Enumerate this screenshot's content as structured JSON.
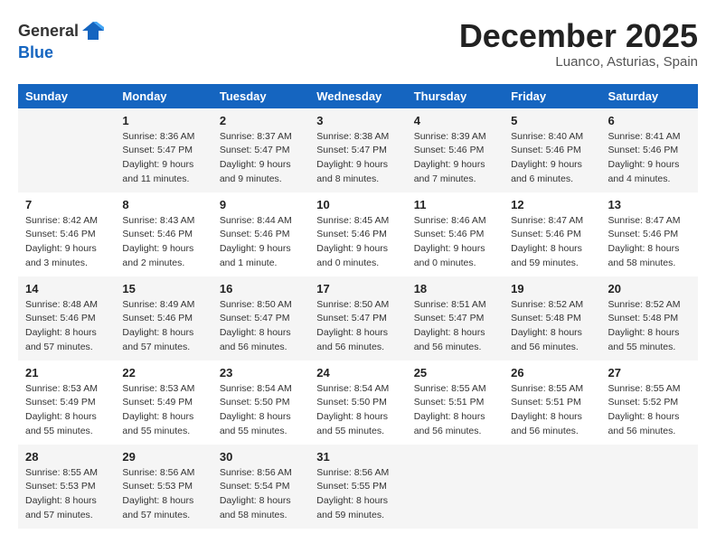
{
  "header": {
    "logo_general": "General",
    "logo_blue": "Blue",
    "month": "December 2025",
    "location": "Luanco, Asturias, Spain"
  },
  "days_of_week": [
    "Sunday",
    "Monday",
    "Tuesday",
    "Wednesday",
    "Thursday",
    "Friday",
    "Saturday"
  ],
  "weeks": [
    [
      {
        "day": "",
        "info": ""
      },
      {
        "day": "1",
        "info": "Sunrise: 8:36 AM\nSunset: 5:47 PM\nDaylight: 9 hours\nand 11 minutes."
      },
      {
        "day": "2",
        "info": "Sunrise: 8:37 AM\nSunset: 5:47 PM\nDaylight: 9 hours\nand 9 minutes."
      },
      {
        "day": "3",
        "info": "Sunrise: 8:38 AM\nSunset: 5:47 PM\nDaylight: 9 hours\nand 8 minutes."
      },
      {
        "day": "4",
        "info": "Sunrise: 8:39 AM\nSunset: 5:46 PM\nDaylight: 9 hours\nand 7 minutes."
      },
      {
        "day": "5",
        "info": "Sunrise: 8:40 AM\nSunset: 5:46 PM\nDaylight: 9 hours\nand 6 minutes."
      },
      {
        "day": "6",
        "info": "Sunrise: 8:41 AM\nSunset: 5:46 PM\nDaylight: 9 hours\nand 4 minutes."
      }
    ],
    [
      {
        "day": "7",
        "info": "Sunrise: 8:42 AM\nSunset: 5:46 PM\nDaylight: 9 hours\nand 3 minutes."
      },
      {
        "day": "8",
        "info": "Sunrise: 8:43 AM\nSunset: 5:46 PM\nDaylight: 9 hours\nand 2 minutes."
      },
      {
        "day": "9",
        "info": "Sunrise: 8:44 AM\nSunset: 5:46 PM\nDaylight: 9 hours\nand 1 minute."
      },
      {
        "day": "10",
        "info": "Sunrise: 8:45 AM\nSunset: 5:46 PM\nDaylight: 9 hours\nand 0 minutes."
      },
      {
        "day": "11",
        "info": "Sunrise: 8:46 AM\nSunset: 5:46 PM\nDaylight: 9 hours\nand 0 minutes."
      },
      {
        "day": "12",
        "info": "Sunrise: 8:47 AM\nSunset: 5:46 PM\nDaylight: 8 hours\nand 59 minutes."
      },
      {
        "day": "13",
        "info": "Sunrise: 8:47 AM\nSunset: 5:46 PM\nDaylight: 8 hours\nand 58 minutes."
      }
    ],
    [
      {
        "day": "14",
        "info": "Sunrise: 8:48 AM\nSunset: 5:46 PM\nDaylight: 8 hours\nand 57 minutes."
      },
      {
        "day": "15",
        "info": "Sunrise: 8:49 AM\nSunset: 5:46 PM\nDaylight: 8 hours\nand 57 minutes."
      },
      {
        "day": "16",
        "info": "Sunrise: 8:50 AM\nSunset: 5:47 PM\nDaylight: 8 hours\nand 56 minutes."
      },
      {
        "day": "17",
        "info": "Sunrise: 8:50 AM\nSunset: 5:47 PM\nDaylight: 8 hours\nand 56 minutes."
      },
      {
        "day": "18",
        "info": "Sunrise: 8:51 AM\nSunset: 5:47 PM\nDaylight: 8 hours\nand 56 minutes."
      },
      {
        "day": "19",
        "info": "Sunrise: 8:52 AM\nSunset: 5:48 PM\nDaylight: 8 hours\nand 56 minutes."
      },
      {
        "day": "20",
        "info": "Sunrise: 8:52 AM\nSunset: 5:48 PM\nDaylight: 8 hours\nand 55 minutes."
      }
    ],
    [
      {
        "day": "21",
        "info": "Sunrise: 8:53 AM\nSunset: 5:49 PM\nDaylight: 8 hours\nand 55 minutes."
      },
      {
        "day": "22",
        "info": "Sunrise: 8:53 AM\nSunset: 5:49 PM\nDaylight: 8 hours\nand 55 minutes."
      },
      {
        "day": "23",
        "info": "Sunrise: 8:54 AM\nSunset: 5:50 PM\nDaylight: 8 hours\nand 55 minutes."
      },
      {
        "day": "24",
        "info": "Sunrise: 8:54 AM\nSunset: 5:50 PM\nDaylight: 8 hours\nand 55 minutes."
      },
      {
        "day": "25",
        "info": "Sunrise: 8:55 AM\nSunset: 5:51 PM\nDaylight: 8 hours\nand 56 minutes."
      },
      {
        "day": "26",
        "info": "Sunrise: 8:55 AM\nSunset: 5:51 PM\nDaylight: 8 hours\nand 56 minutes."
      },
      {
        "day": "27",
        "info": "Sunrise: 8:55 AM\nSunset: 5:52 PM\nDaylight: 8 hours\nand 56 minutes."
      }
    ],
    [
      {
        "day": "28",
        "info": "Sunrise: 8:55 AM\nSunset: 5:53 PM\nDaylight: 8 hours\nand 57 minutes."
      },
      {
        "day": "29",
        "info": "Sunrise: 8:56 AM\nSunset: 5:53 PM\nDaylight: 8 hours\nand 57 minutes."
      },
      {
        "day": "30",
        "info": "Sunrise: 8:56 AM\nSunset: 5:54 PM\nDaylight: 8 hours\nand 58 minutes."
      },
      {
        "day": "31",
        "info": "Sunrise: 8:56 AM\nSunset: 5:55 PM\nDaylight: 8 hours\nand 59 minutes."
      },
      {
        "day": "",
        "info": ""
      },
      {
        "day": "",
        "info": ""
      },
      {
        "day": "",
        "info": ""
      }
    ]
  ]
}
